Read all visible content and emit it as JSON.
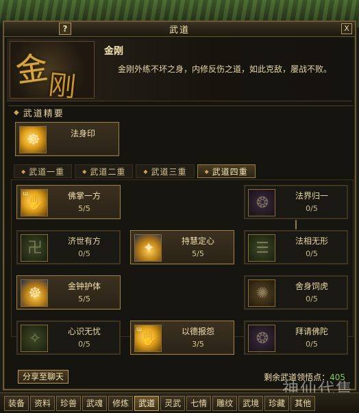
{
  "window": {
    "title": "武道",
    "help_label": "?",
    "close_label": "X"
  },
  "header": {
    "emblem_char1": "金",
    "emblem_char2": "刚",
    "name": "金刚",
    "description": "金刚外练不坏之身，内修反伤之道，如此克敌，屡战不败。"
  },
  "essence": {
    "section_label": "武道精要",
    "skill": {
      "name": "法身印",
      "icon": "golden-seal-icon"
    }
  },
  "tabs": [
    {
      "label": "武道一重",
      "active": false
    },
    {
      "label": "武道二重",
      "active": false
    },
    {
      "label": "武道三重",
      "active": false
    },
    {
      "label": "武道四重",
      "active": true
    }
  ],
  "skills": [
    {
      "name": "佛掌一方",
      "level": "5/5",
      "icon": "buddha-palm-icon"
    },
    {
      "name": "法界归一",
      "level": "0/5",
      "icon": "dharma-realm-icon"
    },
    {
      "name": "济世有方",
      "level": "0/5",
      "icon": "swastika-icon"
    },
    {
      "name": "持慧定心",
      "level": "5/5",
      "icon": "wisdom-shield-icon"
    },
    {
      "name": "法相无形",
      "level": "0/5",
      "icon": "formless-icon"
    },
    {
      "name": "金钟护体",
      "level": "5/5",
      "icon": "golden-bell-icon"
    },
    {
      "name": "舍身饲虎",
      "level": "0/5",
      "icon": "tiger-icon"
    },
    {
      "name": "心识无忧",
      "level": "0/5",
      "icon": "mind-icon"
    },
    {
      "name": "以德报怨",
      "level": "3/5",
      "icon": "virtue-icon"
    },
    {
      "name": "拜请佛陀",
      "level": "0/5",
      "icon": "buddha-icon"
    }
  ],
  "footer": {
    "share_label": "分享至聊天",
    "points_label": "剩余武道领悟点：",
    "points_value": "405"
  },
  "bottom_tabs": [
    "装备",
    "资料",
    "珍兽",
    "武魂",
    "修炼",
    "武道",
    "灵武",
    "七情",
    "雕纹",
    "武境",
    "珍藏",
    "其他"
  ],
  "bottom_active": "武道",
  "watermark": "神仙代售"
}
